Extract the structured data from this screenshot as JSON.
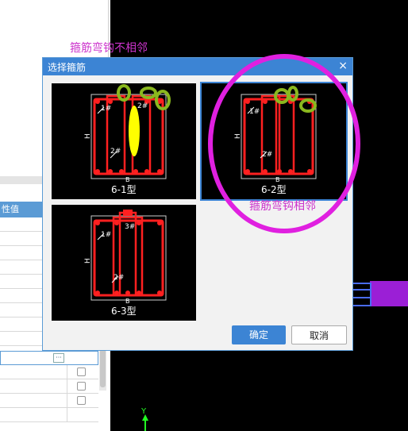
{
  "dialog": {
    "title": "选择箍筋",
    "close_glyph": "×",
    "ok_label": "确定",
    "cancel_label": "取消",
    "options": [
      {
        "label": "6-1型",
        "selected": false
      },
      {
        "label": "6-2型",
        "selected": true
      },
      {
        "label": "6-3型",
        "selected": false
      }
    ]
  },
  "diagram": {
    "h_label": "H",
    "b_label": "B",
    "bar1_label": "1#",
    "bar2_label": "2#",
    "bar3_label": "3#"
  },
  "properties": {
    "header": "性值",
    "ellipsis": "···"
  },
  "annotations": {
    "top": "箍筋弯钩不相邻",
    "bottom": "箍筋弯钩相邻"
  },
  "cad": {
    "axis_y": "Y"
  },
  "colors": {
    "accent": "#3c84d4",
    "annotation": "#e020e0",
    "rebar": "#ff2020",
    "marker_green": "#8ab81e",
    "marker_yellow": "#ffff00"
  }
}
